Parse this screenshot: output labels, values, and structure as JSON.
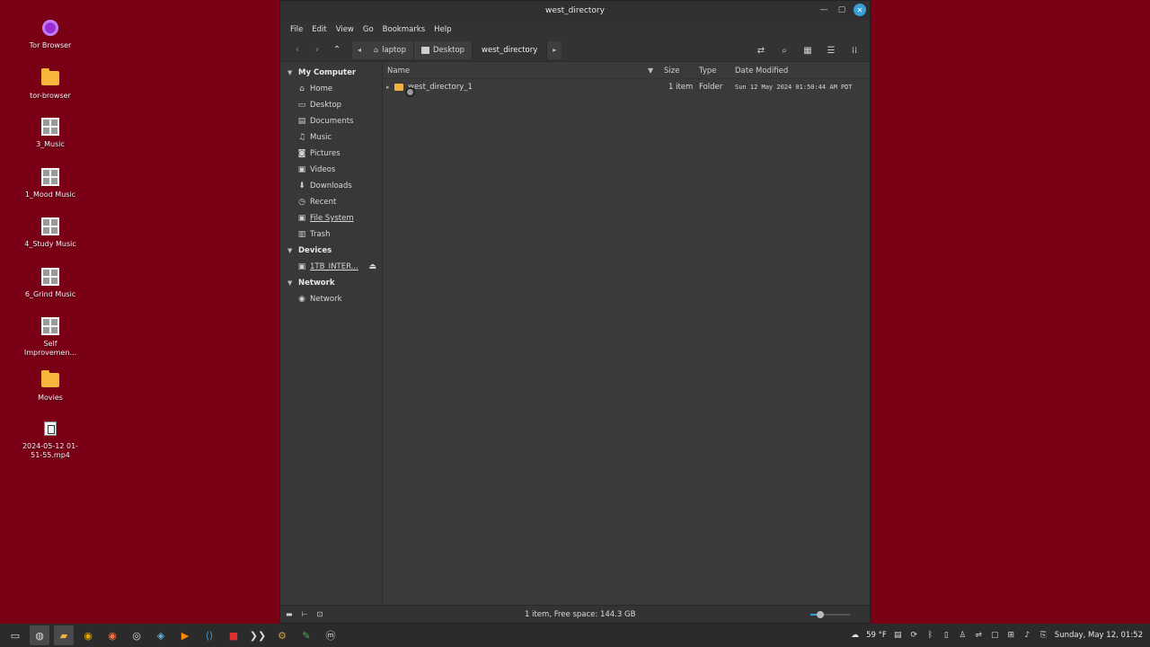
{
  "desktop": {
    "icons": [
      {
        "label": "Tor Browser",
        "icon": "tor-browser-icon"
      },
      {
        "label": "tor-browser",
        "icon": "folder-icon"
      },
      {
        "label": "3_Music",
        "icon": "playlist-icon"
      },
      {
        "label": "1_Mood Music",
        "icon": "playlist-icon"
      },
      {
        "label": "4_Study Music",
        "icon": "playlist-icon"
      },
      {
        "label": "6_Grind Music",
        "icon": "playlist-icon"
      },
      {
        "label": "Self Improvemen...",
        "icon": "playlist-icon"
      },
      {
        "label": "Movies",
        "icon": "folder-icon"
      },
      {
        "label": "2024-05-12 01-51-55.mp4",
        "icon": "video-file-icon"
      }
    ]
  },
  "window": {
    "title": "west_directory",
    "menu": [
      "File",
      "Edit",
      "View",
      "Go",
      "Bookmarks",
      "Help"
    ],
    "breadcrumbs": [
      {
        "label": "laptop",
        "icon": "home-icon"
      },
      {
        "label": "Desktop",
        "icon": "desktop-icon"
      },
      {
        "label": "west_directory",
        "icon": ""
      }
    ]
  },
  "sidebar": {
    "sections": [
      {
        "title": "My Computer",
        "items": [
          {
            "label": "Home",
            "icon": "home-icon"
          },
          {
            "label": "Desktop",
            "icon": "desktop-icon"
          },
          {
            "label": "Documents",
            "icon": "documents-icon"
          },
          {
            "label": "Music",
            "icon": "music-icon"
          },
          {
            "label": "Pictures",
            "icon": "pictures-icon"
          },
          {
            "label": "Videos",
            "icon": "videos-icon"
          },
          {
            "label": "Downloads",
            "icon": "downloads-icon"
          },
          {
            "label": "Recent",
            "icon": "recent-icon"
          },
          {
            "label": "File System",
            "icon": "filesystem-icon"
          },
          {
            "label": "Trash",
            "icon": "trash-icon"
          }
        ]
      },
      {
        "title": "Devices",
        "items": [
          {
            "label": "1TB_INTER...",
            "icon": "drive-icon"
          }
        ]
      },
      {
        "title": "Network",
        "items": [
          {
            "label": "Network",
            "icon": "network-icon"
          }
        ]
      }
    ]
  },
  "file_list": {
    "columns": {
      "name": "Name",
      "size": "Size",
      "type": "Type",
      "date": "Date Modified"
    },
    "rows": [
      {
        "name": "west_directory_1",
        "size": "1 item",
        "type": "Folder",
        "date": "Sun 12 May 2024 01:50:44 AM PDT"
      }
    ]
  },
  "status": {
    "text": "1 item, Free space: 144.3 GB",
    "zoom_fraction": 0.25
  },
  "taskbar": {
    "weather": "59 °F",
    "clock": "Sunday, May 12, 01:52"
  },
  "colors": {
    "desktop_bg": "#7a0016",
    "accent": "#3aa0d8",
    "folder": "#f0b040"
  }
}
